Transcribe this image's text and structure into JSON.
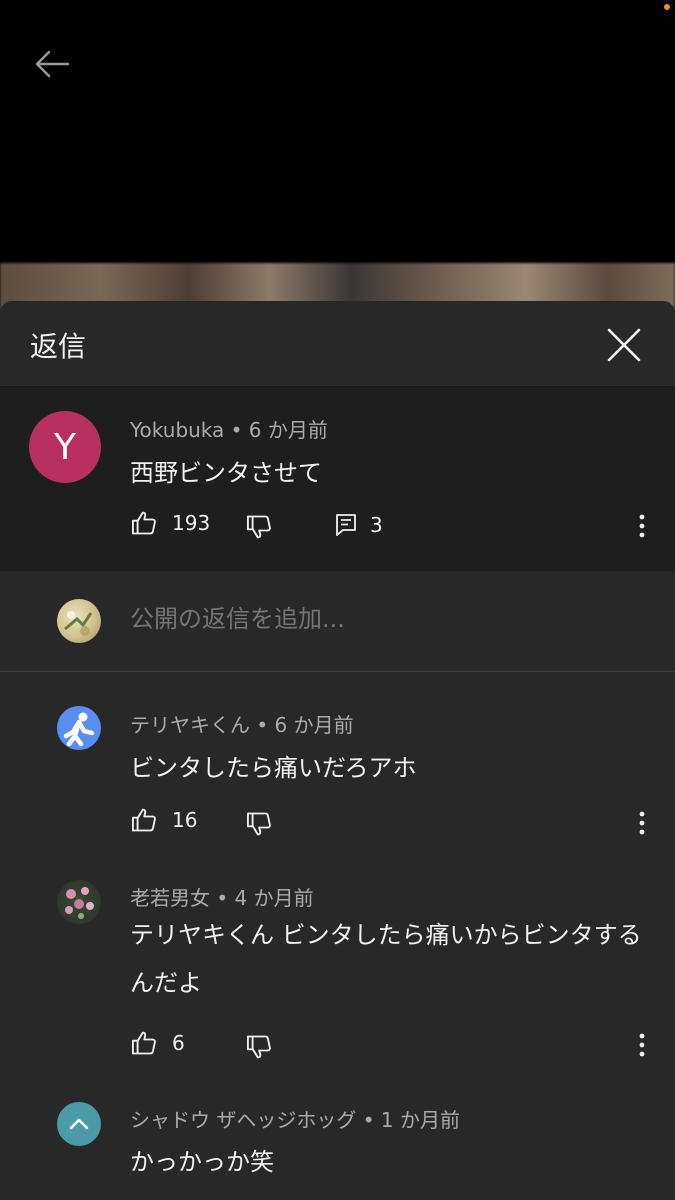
{
  "colors": {
    "accent_status": "#f28c28",
    "avatar_y": "#b8305f",
    "avatar_teriyaki": "#5b8def",
    "avatar_shadow": "#4a9aa8"
  },
  "icons": [
    "back-arrow-icon",
    "close-icon",
    "thumbs-up-icon",
    "thumbs-down-icon",
    "reply-icon",
    "more-vert-icon",
    "chevron-up-icon"
  ],
  "panel": {
    "title": "返信"
  },
  "parent_comment": {
    "avatar_letter": "Y",
    "author": "Yokubuka",
    "time": "• 6 か月前",
    "text": "西野ビンタさせて",
    "likes": "193",
    "replies": "3"
  },
  "add_reply": {
    "placeholder": "公開の返信を追加..."
  },
  "replies": [
    {
      "author": "テリヤキくん",
      "time": "• 6 か月前",
      "text": "ビンタしたら痛いだろアホ",
      "likes": "16"
    },
    {
      "author": "老若男女",
      "time": "• 4 か月前",
      "text": "テリヤキくん ビンタしたら痛いからビンタするんだよ",
      "likes": "6"
    },
    {
      "author": "シャドウ ザヘッジホッグ",
      "time": "• 1 か月前",
      "text": "かっかっか笑"
    }
  ]
}
